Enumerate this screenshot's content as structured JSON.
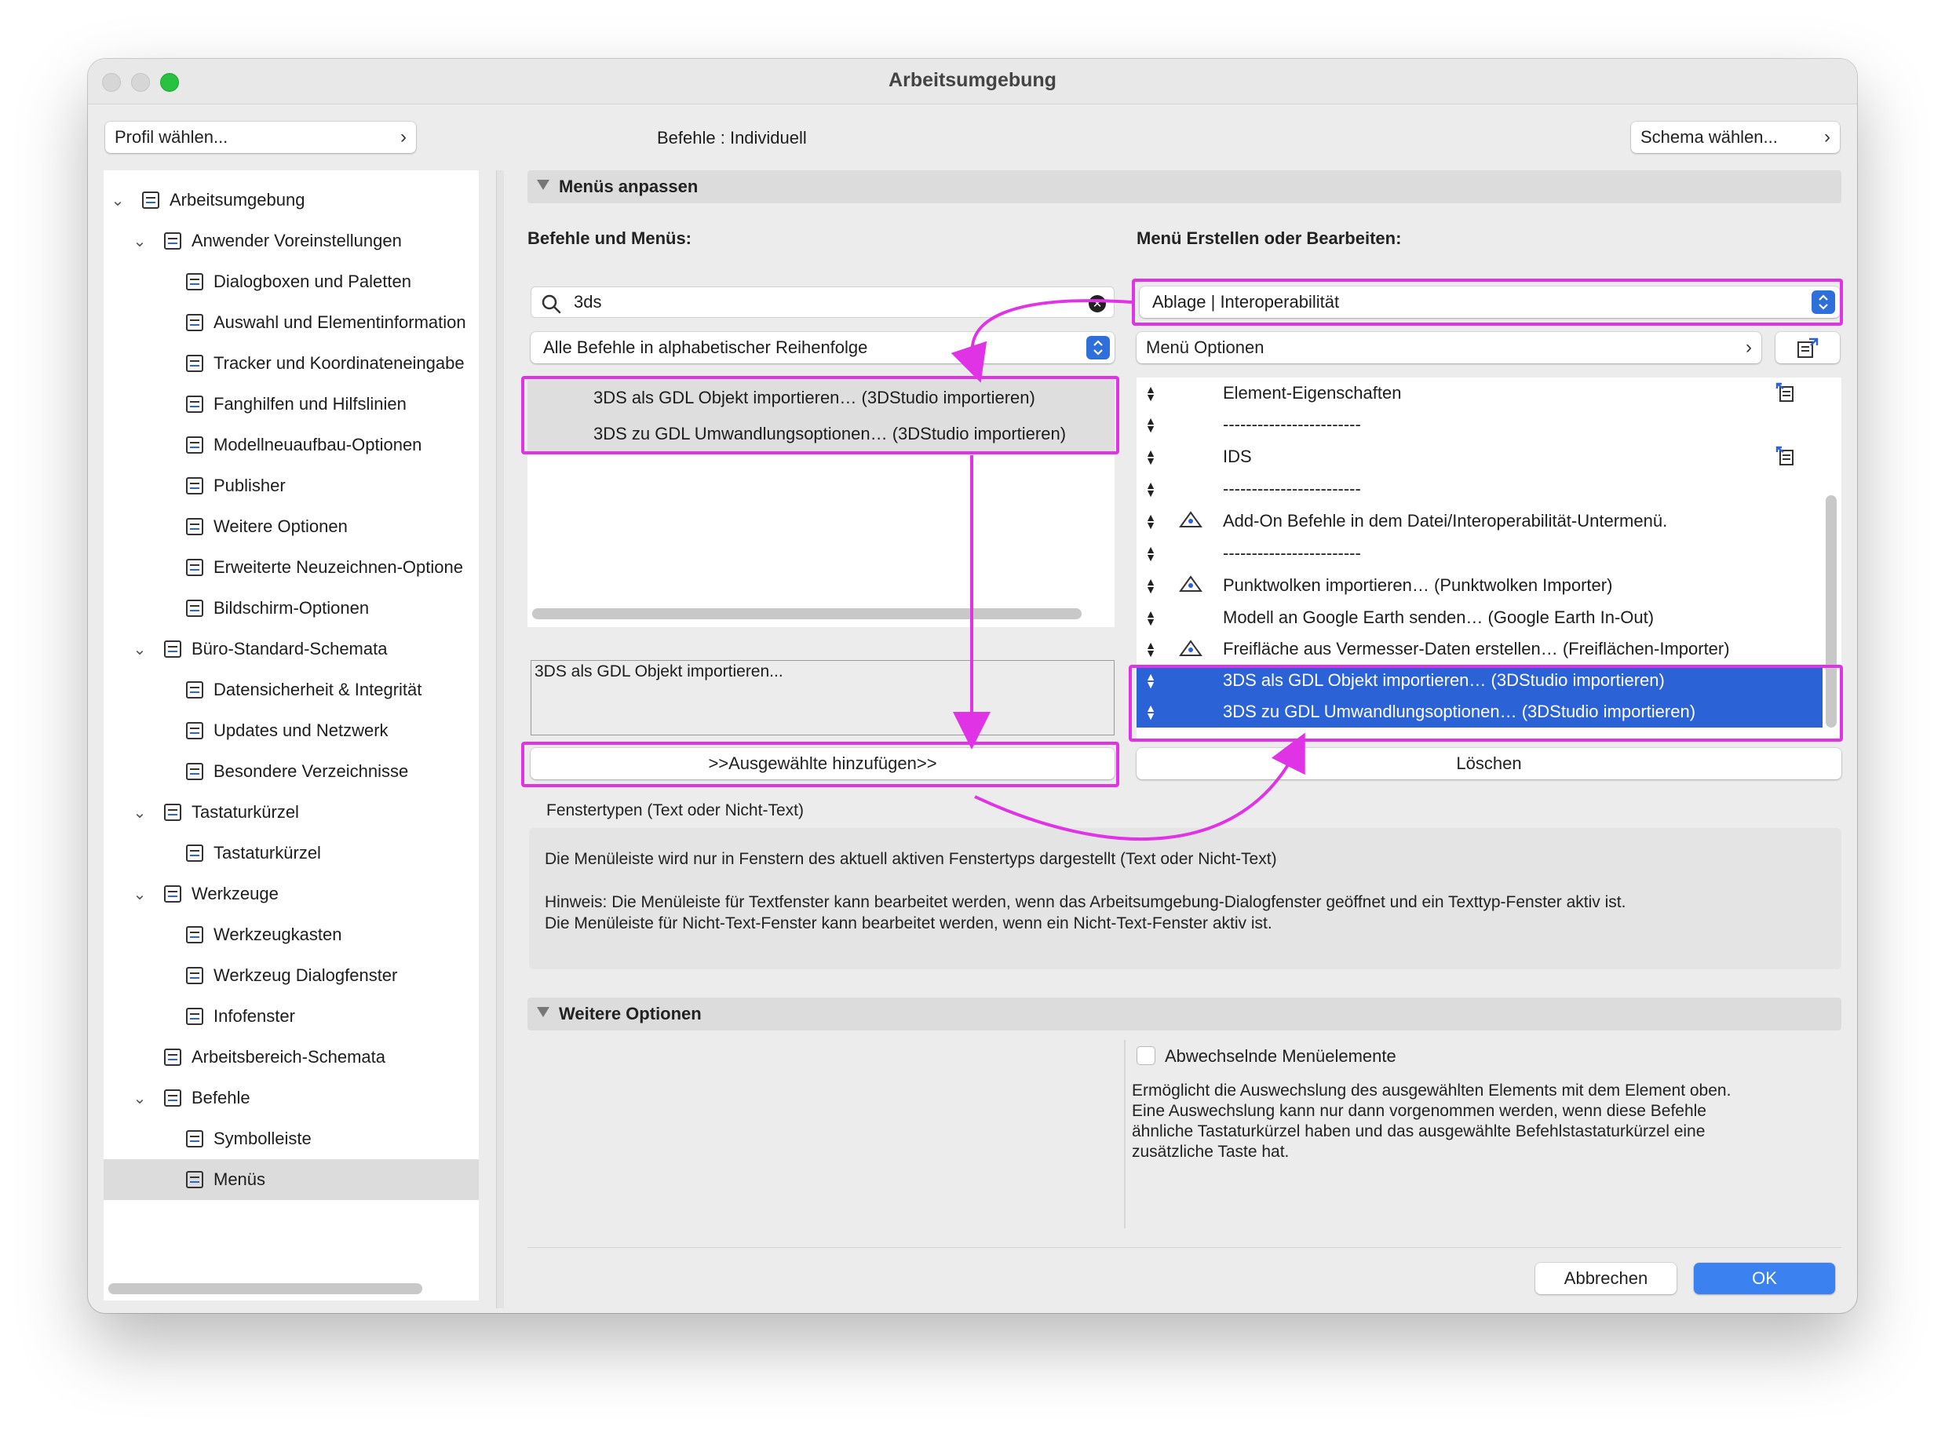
{
  "window": {
    "title": "Arbeitsumgebung"
  },
  "top": {
    "profile_button": "Profil wählen...",
    "commands_label": "Befehle : Individuell",
    "schema_button": "Schema wählen..."
  },
  "sidebar": {
    "items": [
      {
        "label": "Arbeitsumgebung",
        "level": 0,
        "expanded": true,
        "icon": "workspace-icon"
      },
      {
        "label": "Anwender Voreinstellungen",
        "level": 1,
        "expanded": true,
        "icon": "user-settings-icon"
      },
      {
        "label": "Dialogboxen und Paletten",
        "level": 2,
        "icon": "dialogs-icon"
      },
      {
        "label": "Auswahl und Elementinformation",
        "level": 2,
        "icon": "selection-icon"
      },
      {
        "label": "Tracker und Koordinateneingabe",
        "level": 2,
        "icon": "xyz-icon"
      },
      {
        "label": "Fanghilfen und Hilfslinien",
        "level": 2,
        "icon": "snap-icon"
      },
      {
        "label": "Modellneuaufbau-Optionen",
        "level": 2,
        "icon": "rebuild-icon"
      },
      {
        "label": "Publisher",
        "level": 2,
        "icon": "publisher-icon"
      },
      {
        "label": "Weitere Optionen",
        "level": 2,
        "icon": "sliders-icon"
      },
      {
        "label": "Erweiterte Neuzeichnen-Optione",
        "level": 2,
        "icon": "redraw-icon"
      },
      {
        "label": "Bildschirm-Optionen",
        "level": 2,
        "icon": "screen-icon"
      },
      {
        "label": "Büro-Standard-Schemata",
        "level": 1,
        "expanded": true,
        "icon": "office-schema-icon"
      },
      {
        "label": "Datensicherheit & Integrität",
        "level": 2,
        "icon": "data-safety-icon"
      },
      {
        "label": "Updates und Netzwerk",
        "level": 2,
        "icon": "globe-icon"
      },
      {
        "label": "Besondere Verzeichnisse",
        "level": 2,
        "icon": "folder-icon"
      },
      {
        "label": "Tastaturkürzel",
        "level": 1,
        "expanded": true,
        "icon": "keyboard-schema-icon"
      },
      {
        "label": "Tastaturkürzel",
        "level": 2,
        "icon": "shortcut-icon"
      },
      {
        "label": "Werkzeuge",
        "level": 1,
        "expanded": true,
        "icon": "tools-schema-icon"
      },
      {
        "label": "Werkzeugkasten",
        "level": 2,
        "icon": "toolbox-icon"
      },
      {
        "label": "Werkzeug Dialogfenster",
        "level": 2,
        "icon": "tool-dialog-icon"
      },
      {
        "label": "Infofenster",
        "level": 2,
        "icon": "infobox-icon"
      },
      {
        "label": "Arbeitsbereich-Schemata",
        "level": 1,
        "icon": "workspace-schema-icon"
      },
      {
        "label": "Befehle",
        "level": 1,
        "expanded": true,
        "icon": "commands-schema-icon"
      },
      {
        "label": "Symbolleiste",
        "level": 2,
        "icon": "toolbar-icon"
      },
      {
        "label": "Menüs",
        "level": 2,
        "selected": true,
        "icon": "menus-icon"
      }
    ]
  },
  "menus_section": {
    "title": "Menüs anpassen",
    "left_label": "Befehle und Menüs:",
    "search_value": "3ds",
    "filter_popup": "Alle Befehle in alphabetischer Reihenfolge",
    "commands": [
      "3DS als GDL Objekt importieren… (3DStudio importieren)",
      "3DS zu GDL Umwandlungsoptionen… (3DStudio importieren)"
    ],
    "description": "3DS als GDL Objekt importieren...",
    "add_button": ">>Ausgewählte hinzufügen>>",
    "right_label": "Menü Erstellen oder Bearbeiten:",
    "menu_popup": "Ablage | Interoperabilität",
    "menu_options": "Menü Optionen",
    "menu_items": [
      {
        "text": "Element-Eigenschaften",
        "right_icon": true
      },
      {
        "text": "------------------------"
      },
      {
        "text": "IDS",
        "right_icon": true
      },
      {
        "text": "------------------------"
      },
      {
        "text": "Add-On Befehle in dem Datei/Interoperabilität-Untermenü.",
        "icon": "addon-icon"
      },
      {
        "text": "------------------------"
      },
      {
        "text": "Punktwolken importieren… (Punktwolken Importer)",
        "icon": "pointcloud-icon"
      },
      {
        "text": "Modell an Google Earth senden… (Google Earth In-Out)"
      },
      {
        "text": "Freifläche aus Vermesser-Daten erstellen… (Freiflächen-Importer)",
        "icon": "survey-icon"
      },
      {
        "text": "3DS als GDL Objekt importieren… (3DStudio importieren)",
        "selected": true
      },
      {
        "text": "3DS zu GDL Umwandlungsoptionen… (3DStudio importieren)",
        "selected": true
      }
    ],
    "delete_button": "Löschen",
    "window_types_label": "Fenstertypen (Text oder Nicht-Text)",
    "info_line1": "Die Menüleiste wird nur in Fenstern des aktuell aktiven Fenstertyps dargestellt (Text oder Nicht-Text)",
    "info_line2": "Hinweis: Die Menüleiste für Textfenster kann bearbeitet werden, wenn das Arbeitsumgebung-Dialogfenster geöffnet und ein Texttyp-Fenster aktiv ist.",
    "info_line3": "Die Menüleiste für Nicht-Text-Fenster kann bearbeitet werden, wenn ein Nicht-Text-Fenster aktiv ist."
  },
  "more_options": {
    "title": "Weitere Optionen",
    "checkbox_label": "Abwechselnde Menüelemente",
    "checkbox_checked": false,
    "desc1": "Ermöglicht die Auswechslung des ausgewählten Elements mit dem Element oben.",
    "desc2": "Eine Auswechslung kann nur dann vorgenommen werden, wenn diese Befehle",
    "desc3": "ähnliche Tastaturkürzel haben und das ausgewählte Befehlstastaturkürzel eine",
    "desc4": "zusätzliche Taste hat."
  },
  "footer": {
    "cancel": "Abbrechen",
    "ok": "OK"
  },
  "colors": {
    "accent": "#2b63d6",
    "annotation": "#e033e6",
    "ok_button": "#3b82f0"
  }
}
